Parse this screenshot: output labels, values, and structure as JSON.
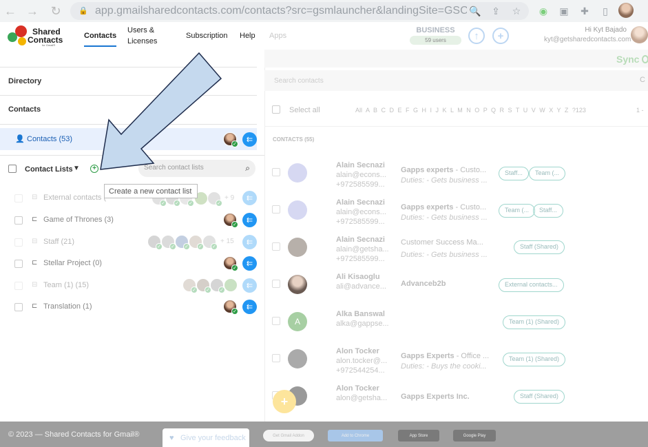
{
  "browser": {
    "url": "app.gmailsharedcontacts.com/contacts?src=gsmlauncher&landingSite=GSC_MARKETPLACE..."
  },
  "app": {
    "logo_line1": "Shared",
    "logo_line2": "Contacts",
    "logo_line3": "for Gmail®",
    "nav": [
      "Contacts",
      "Users &",
      "Licenses",
      "Subscription",
      "Help",
      "Apps"
    ],
    "plan_label": "BUSINESS",
    "plan_users": "59 users",
    "greeting": "Hi Kyt Bajado",
    "email": "kyt@getsharedcontacts.com",
    "sync_label": "Sync"
  },
  "sidebar": {
    "directory": "Directory",
    "contacts_header": "Contacts",
    "contacts_item": "Contacts (53)",
    "contact_lists_label": "Contact Lists",
    "search_placeholder": "Search contact lists",
    "tooltip": "Create a new contact list",
    "lists": [
      {
        "name": "External contacts (",
        "more": "+ 9"
      },
      {
        "name": "Game of Thrones (3)",
        "more": ""
      },
      {
        "name": "Staff (21)",
        "more": "+ 15"
      },
      {
        "name": "Stellar Project (0)",
        "more": ""
      },
      {
        "name": "Team (1) (15)",
        "more": ""
      },
      {
        "name": "Translation (1)",
        "more": ""
      }
    ]
  },
  "main": {
    "search_placeholder": "Search contacts",
    "select_all": "Select all",
    "alphabet": "All A B C D E F G H I J K L M N O P Q R S T U V W X Y Z ?123",
    "pagination": "1 -",
    "count_label": "CONTACTS (55)",
    "contacts": [
      {
        "name": "Alain Secnazi",
        "email": "alain@econs...",
        "phone": "+972585599...",
        "company": "Gapps experts",
        "title": " - Custo...",
        "duties": "Duties: - Gets business ...",
        "chips": [
          "Staff...",
          "Team (..."
        ]
      },
      {
        "name": "Alain Secnazi",
        "email": "alain@econs...",
        "phone": "+972585599...",
        "company": "Gapps experts",
        "title": " - Custo...",
        "duties": "Duties: - Gets business ...",
        "chips": [
          "Team (...",
          "Staff..."
        ]
      },
      {
        "name": "Alain Secnazi",
        "email": "alain@getsha...",
        "phone": "+972585599...",
        "company": "Customer Success Ma...",
        "title": "",
        "duties": "Duties: - Gets business ...",
        "chips": [
          "Staff (Shared)"
        ]
      },
      {
        "name": "Ali Kisaoglu",
        "email": "ali@advance...",
        "phone": "",
        "company": "Advanceb2b",
        "title": "",
        "duties": "",
        "chips": [
          "External contacts..."
        ]
      },
      {
        "name": "Alka Banswal",
        "email": "alka@gappse...",
        "phone": "",
        "company": "",
        "title": "",
        "duties": "",
        "chips": [
          "Team (1) (Shared)"
        ],
        "initial": "A"
      },
      {
        "name": "Alon Tocker",
        "email": "alon.tocker@...",
        "phone": "+972544254...",
        "company": "Gapps Experts",
        "title": " - Office ...",
        "duties": "Duties: - Buys the cooki...",
        "chips": [
          "Team (1) (Shared)"
        ]
      },
      {
        "name": "Alon Tocker",
        "email": "alon@getsha...",
        "phone": "",
        "company": "Gapps Experts Inc.",
        "title": "",
        "duties": "",
        "chips": [
          "Staff (Shared)"
        ]
      }
    ]
  },
  "footer": {
    "copyright": "© 2023 — Shared Contacts for Gmail®",
    "feedback": "Give your feedback",
    "badges": [
      "Get Gmail Addon",
      "Add to Chrome",
      "App Store",
      "Google Play"
    ]
  },
  "colors": {
    "accent": "#1a73e8",
    "green": "#2e9c46",
    "arrow_fill": "#c5d9ee",
    "arrow_stroke": "#1f2d4d"
  }
}
